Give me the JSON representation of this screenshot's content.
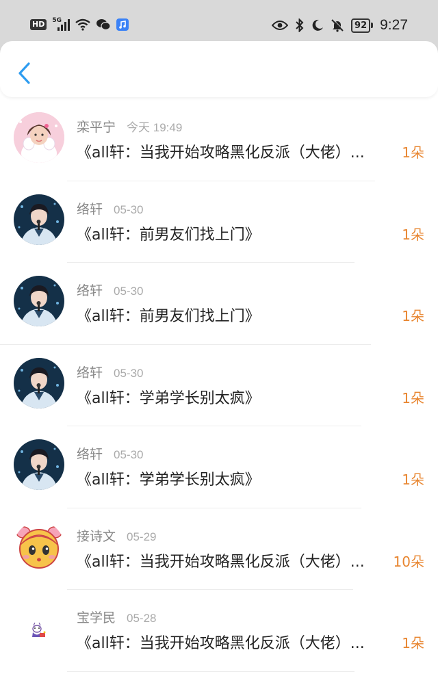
{
  "status_bar": {
    "hd": "HD",
    "network": "5G",
    "battery": "92",
    "time": "9:27"
  },
  "header": {
    "back_icon": "chevron-left-icon",
    "accent": "#2d9cf0"
  },
  "items": [
    {
      "name": "栾平宁",
      "date": "今天 19:49",
      "title": "《all轩：当我开始攻略黑化反派（大佬）...",
      "count": "1朵",
      "avatar": "baby-avatar"
    },
    {
      "name": "络轩",
      "date": "05-30",
      "title": "《all轩：前男友们找上门》",
      "count": "1朵",
      "avatar": "singer-avatar"
    },
    {
      "name": "络轩",
      "date": "05-30",
      "title": "《all轩：前男友们找上门》",
      "count": "1朵",
      "avatar": "singer-avatar"
    },
    {
      "name": "络轩",
      "date": "05-30",
      "title": "《all轩：学弟学长别太疯》",
      "count": "1朵",
      "avatar": "singer-avatar"
    },
    {
      "name": "络轩",
      "date": "05-30",
      "title": "《all轩：学弟学长别太疯》",
      "count": "1朵",
      "avatar": "singer-avatar"
    },
    {
      "name": "接诗文",
      "date": "05-29",
      "title": "《all轩：当我开始攻略黑化反派（大佬）...",
      "count": "10朵",
      "avatar": "cartoon-girl-avatar"
    },
    {
      "name": "宝学民",
      "date": "05-28",
      "title": "《all轩：当我开始攻略黑化反派（大佬）...",
      "count": "1朵",
      "avatar": "small-sticker-avatar"
    }
  ],
  "colors": {
    "count": "#e8852f",
    "name": "#888888",
    "date": "#aaaaaa"
  }
}
